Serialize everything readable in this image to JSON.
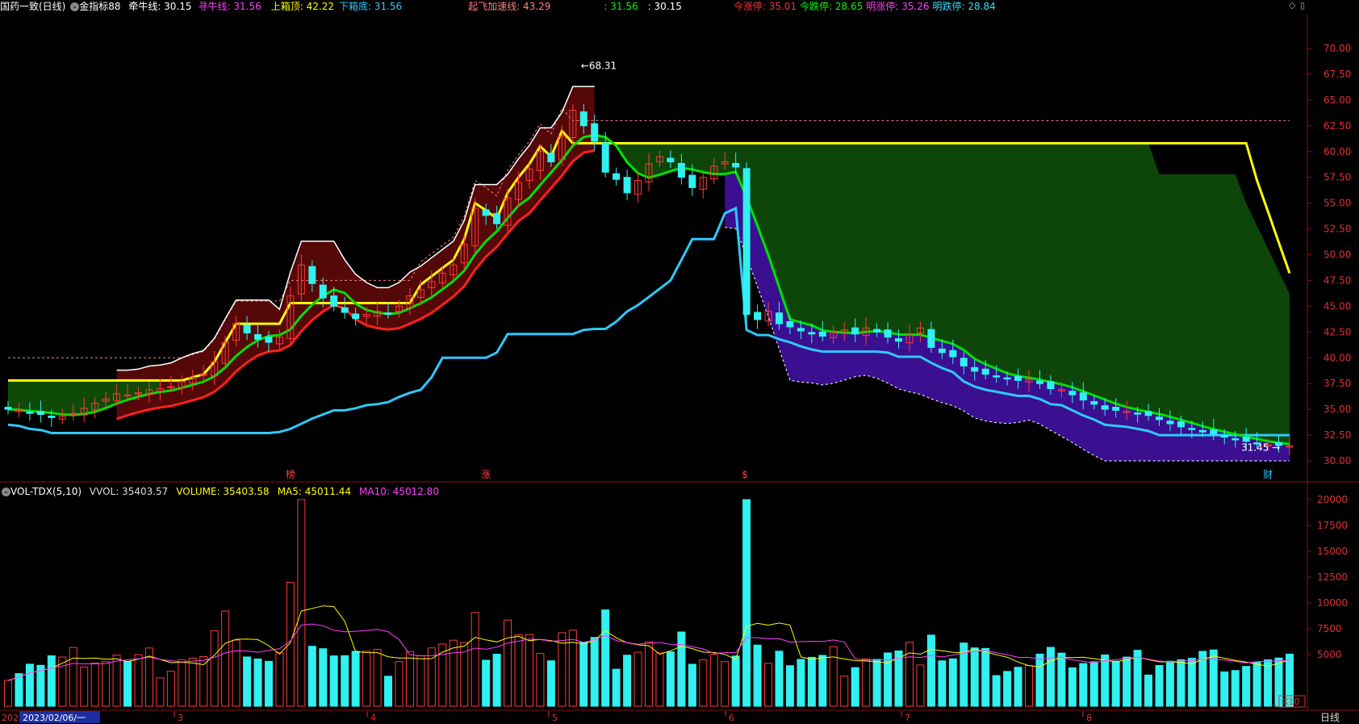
{
  "main_header": {
    "symbol": "国药一致(日线)",
    "indicator": "金指标88",
    "items": [
      {
        "label": "牵牛线: ",
        "value": "30.15",
        "color": "#ffffff"
      },
      {
        "label": "寻牛线: ",
        "value": "31.56",
        "color": "#ff40ff"
      },
      {
        "label": "上箱顶: ",
        "value": "42.22",
        "color": "#ffff00"
      },
      {
        "label": "下箱底: ",
        "value": "31.56",
        "color": "#30c8ff"
      },
      {
        "label": "起飞加速线: ",
        "value": "43.29",
        "color": "#ff8080"
      },
      {
        "label": ": ",
        "value": "31.56",
        "color": "#00ff00"
      },
      {
        "label": ": ",
        "value": "30.15",
        "color": "#ffffff"
      },
      {
        "label": "今涨停: ",
        "value": "35.01",
        "color": "#ff3030"
      },
      {
        "label": "今跌停: ",
        "value": "28.65",
        "color": "#00ff00"
      },
      {
        "label": "明涨停: ",
        "value": "35.26",
        "color": "#ff40ff"
      },
      {
        "label": "明跌停: ",
        "value": "28.84",
        "color": "#30e0ff"
      }
    ]
  },
  "vol_header": {
    "indicator": "VOL-TDX(5,10)",
    "items": [
      {
        "label": "VVOL: ",
        "value": "35403.57",
        "color": "#dddddd"
      },
      {
        "label": "VOLUME: ",
        "value": "35403.58",
        "color": "#ffff00"
      },
      {
        "label": "MA5: ",
        "value": "45011.44",
        "color": "#ffff00"
      },
      {
        "label": "MA10: ",
        "value": "45012.80",
        "color": "#ff40ff"
      }
    ]
  },
  "price_axis": [
    "70.00",
    "67.50",
    "65.00",
    "62.50",
    "60.00",
    "57.50",
    "55.00",
    "52.50",
    "50.00",
    "47.50",
    "45.00",
    "42.50",
    "40.00",
    "37.50",
    "35.00",
    "32.50",
    "30.00"
  ],
  "volume_axis": [
    "20000",
    "17500",
    "15000",
    "12500",
    "10000",
    "7500",
    "5000"
  ],
  "volume_multiplier": "X10",
  "time_axis": {
    "start_label": "2023/02/06/一",
    "year_fragment": "2023",
    "months": [
      "3",
      "4",
      "5",
      "6",
      "7",
      "8"
    ],
    "period_label": "日线"
  },
  "annotations": {
    "peak_price": "68.31",
    "last_price": "31.45",
    "signals": [
      "榜",
      "涨",
      "$",
      "财"
    ]
  },
  "colors": {
    "up": "#ff3a3a",
    "down": "#30f0f0",
    "box_top": "#ffff00",
    "box_bottom": "#30c8ff",
    "green_line": "#00e000",
    "red_line": "#ff2020",
    "white_line": "#ffffff",
    "green_fill": "#0e4a08",
    "red_fill": "#5a0808",
    "purple_fill": "#3a1090",
    "grid": "#8a1010"
  },
  "chart_data": {
    "type": "candlestick",
    "price_ylim": [
      29.5,
      71.5
    ],
    "volume_ylim": [
      0,
      20500
    ],
    "close_series": [
      35.0,
      34.9,
      34.6,
      34.5,
      34.2,
      34.3,
      34.6,
      35.1,
      35.6,
      36.0,
      36.5,
      36.4,
      36.6,
      36.9,
      37.0,
      37.2,
      37.7,
      38.1,
      38.4,
      39.6,
      41.5,
      43.3,
      42.4,
      41.8,
      41.5,
      42.0,
      46.0,
      49.0,
      47.2,
      45.8,
      45.0,
      44.4,
      43.8,
      44.2,
      44.5,
      44.3,
      45.0,
      46.0,
      46.6,
      47.4,
      48.2,
      49.0,
      51.0,
      54.5,
      53.8,
      53.0,
      55.5,
      57.0,
      58.3,
      60.0,
      59.0,
      61.5,
      64.0,
      62.5,
      61.0,
      58.0,
      57.3,
      56.0,
      57.2,
      58.8,
      59.5,
      59.0,
      57.5,
      56.5,
      57.5,
      58.6,
      59.0,
      58.5,
      44.2,
      43.7,
      44.5,
      43.3,
      43.0,
      42.6,
      42.3,
      42.1,
      42.5,
      42.7,
      42.3,
      42.9,
      42.5,
      42.0,
      41.6,
      42.2,
      42.9,
      41.0,
      40.5,
      40.1,
      39.2,
      38.7,
      38.4,
      38.2,
      38.0,
      37.8,
      37.9,
      37.5,
      37.0,
      36.9,
      36.4,
      35.9,
      35.5,
      35.0,
      34.9,
      34.8,
      34.6,
      34.4,
      34.0,
      33.6,
      33.3,
      33.1,
      32.8,
      32.6,
      32.3,
      32.1,
      31.9,
      31.7,
      31.56,
      31.5,
      31.45
    ]
  }
}
